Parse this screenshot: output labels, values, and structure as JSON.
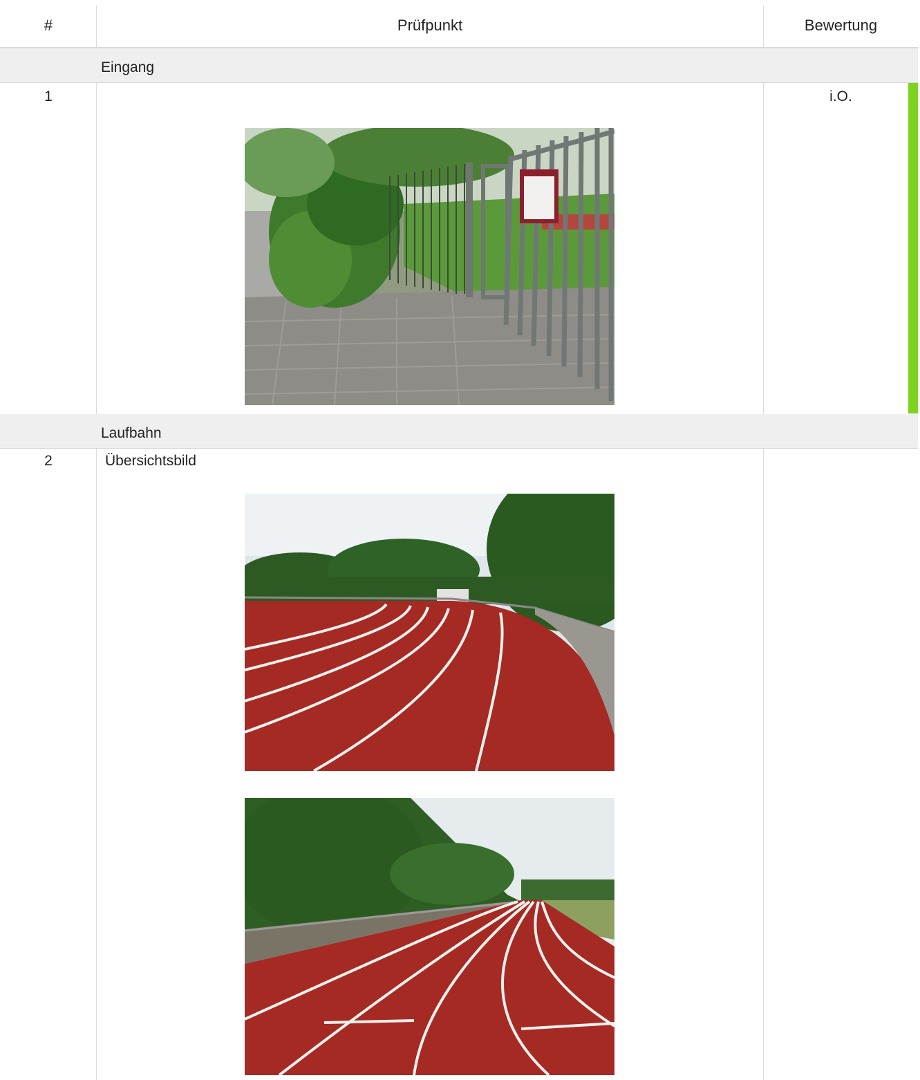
{
  "table": {
    "headers": {
      "num": "#",
      "point": "Prüfpunkt",
      "rating": "Bewertung"
    },
    "sections": [
      {
        "title": "Eingang",
        "rows": [
          {
            "num": "1",
            "text": "",
            "rating": "i.O.",
            "rating_color": "#7ed321",
            "photos": [
              "entrance-gate-photo"
            ]
          }
        ]
      },
      {
        "title": "Laufbahn",
        "rows": [
          {
            "num": "2",
            "text": "Übersichtsbild",
            "rating": "",
            "photos": [
              "running-track-curve-photo",
              "running-track-straight-photo"
            ]
          }
        ]
      }
    ]
  },
  "colors": {
    "rating_ok": "#7ed321",
    "section_bg": "#efefef",
    "track_red": "#a52a24"
  }
}
